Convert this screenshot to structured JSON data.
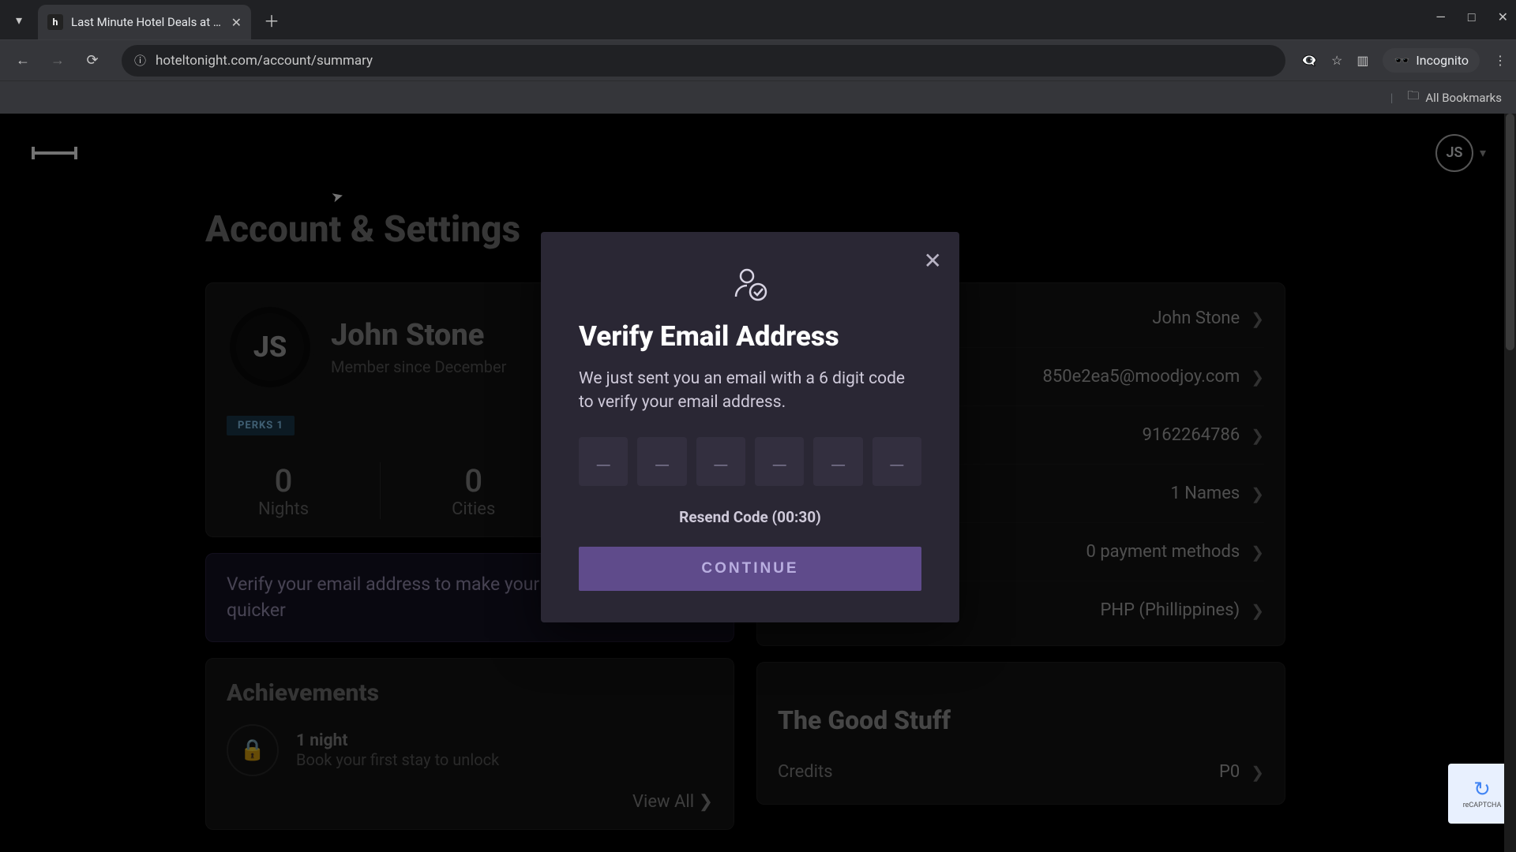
{
  "browser": {
    "tab_title": "Last Minute Hotel Deals at Gre",
    "url": "hoteltonight.com/account/summary",
    "incognito_label": "Incognito",
    "all_bookmarks": "All Bookmarks"
  },
  "header": {
    "avatar_initials": "JS"
  },
  "page": {
    "title": "Account & Settings"
  },
  "profile": {
    "avatar_initials": "JS",
    "name": "John Stone",
    "member_since": "Member since December",
    "perks_label": "PERKS 1",
    "stats": {
      "nights_n": "0",
      "nights_l": "Nights",
      "cities_n": "0",
      "cities_l": "Cities"
    }
  },
  "verify_banner": "Verify your email address to make your booking experience quicker",
  "achievements": {
    "title": "Achievements",
    "item_title": "1 night",
    "item_sub": "Book your first stay to unlock",
    "view_all": "View All"
  },
  "details": {
    "rows": [
      {
        "value": "John Stone"
      },
      {
        "value": "850e2ea5@moodjoy.com"
      },
      {
        "value": "9162264786"
      },
      {
        "value": "1 Names"
      },
      {
        "value": "0 payment methods"
      },
      {
        "value": "PHP (Phillippines)"
      }
    ]
  },
  "goodstuff": {
    "title": "The Good Stuff",
    "credits_label": "Credits",
    "credits_value": "P0"
  },
  "modal": {
    "title": "Verify Email Address",
    "body": "We just sent you an email with a 6 digit code to verify your email address.",
    "resend": "Resend Code (00:30)",
    "continue": "CONTINUE"
  },
  "recaptcha": {
    "label": "reCAPTCHA"
  }
}
